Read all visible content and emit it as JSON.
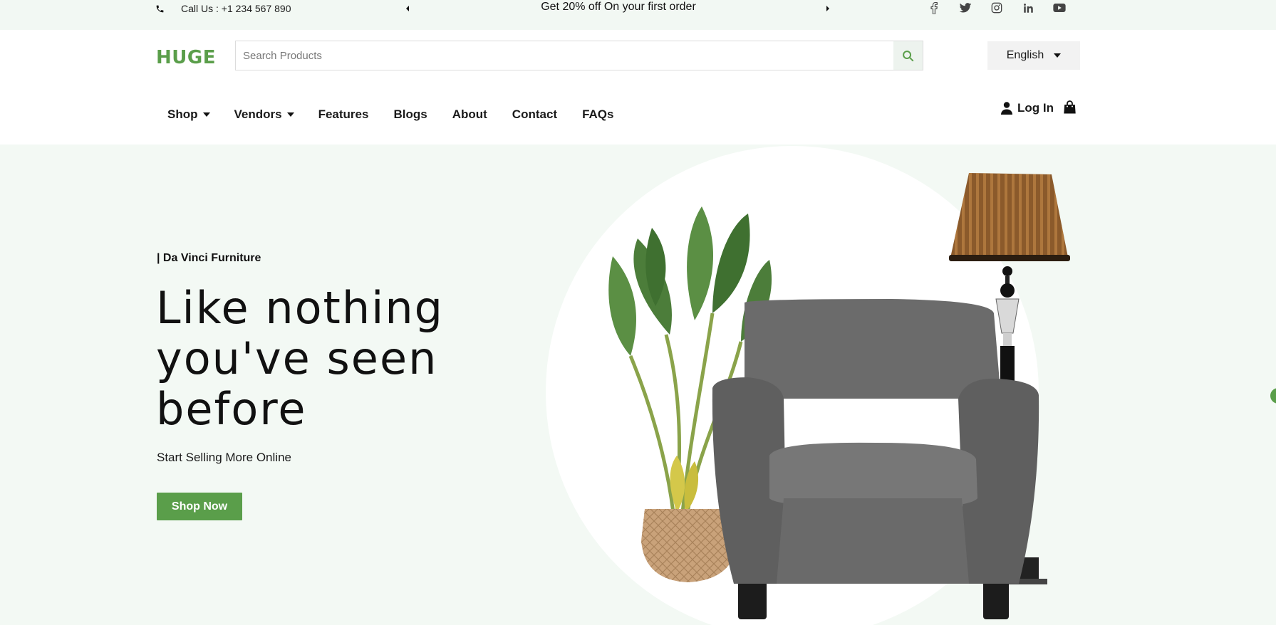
{
  "topbar": {
    "phone_icon": "phone-icon",
    "phone_text": "Call Us : +1 234 567 890",
    "promo_text": "Get 20% off On your first order",
    "socials": [
      "facebook-icon",
      "twitter-icon",
      "instagram-icon",
      "linkedin-icon",
      "youtube-icon"
    ]
  },
  "header": {
    "logo": "HUGE",
    "search_placeholder": "Search Products",
    "language": "English"
  },
  "nav": {
    "items": [
      {
        "label": "Shop",
        "has_dropdown": true
      },
      {
        "label": "Vendors",
        "has_dropdown": true
      },
      {
        "label": "Features",
        "has_dropdown": false
      },
      {
        "label": "Blogs",
        "has_dropdown": false
      },
      {
        "label": "About",
        "has_dropdown": false
      },
      {
        "label": "Contact",
        "has_dropdown": false
      },
      {
        "label": "FAQs",
        "has_dropdown": false
      }
    ],
    "login_label": "Log In"
  },
  "hero": {
    "eyebrow": "| Da Vinci Furniture",
    "headline": "Like nothing you've seen before",
    "subline": "Start Selling More Online",
    "cta_label": "Shop Now"
  },
  "colors": {
    "brand_green": "#5a9e4a",
    "hero_bg": "#f3f9f4",
    "topbar_bg": "#f2f8f3"
  }
}
